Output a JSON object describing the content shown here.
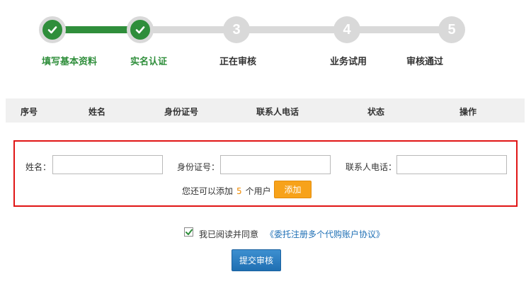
{
  "progress": {
    "steps": [
      {
        "number": "1",
        "label": "填写基本资料",
        "status": "done"
      },
      {
        "number": "2",
        "label": "实名认证",
        "status": "done"
      },
      {
        "number": "3",
        "label": "正在审核",
        "status": "pending"
      },
      {
        "number": "4",
        "label": "业务试用",
        "status": "pending"
      },
      {
        "number": "5",
        "label": "审核通过",
        "status": "pending"
      }
    ],
    "done_color": "#2f8e3b",
    "pending_color": "#d9d9d9",
    "done_icon": "check-icon"
  },
  "table": {
    "columns": [
      "序号",
      "姓名",
      "身份证号",
      "联系人电话",
      "状态",
      "操作"
    ]
  },
  "form": {
    "name_label": "姓名：",
    "name_value": "",
    "id_label": "身份证号：",
    "id_value": "",
    "phone_label": "联系人电话：",
    "phone_value": "",
    "hint_prefix": "您还可以添加",
    "remaining_count": "5",
    "hint_suffix": "个用户",
    "add_button": "添加",
    "border_color": "#e01515",
    "add_button_color": "#f7a21a"
  },
  "agreement": {
    "checked": true,
    "text": "我已阅读并同意",
    "link_text": "《委托注册多个代购账户协议》",
    "link_color": "#1e6fb5"
  },
  "submit": {
    "label": "提交审核",
    "color": "#2a7cc0"
  }
}
